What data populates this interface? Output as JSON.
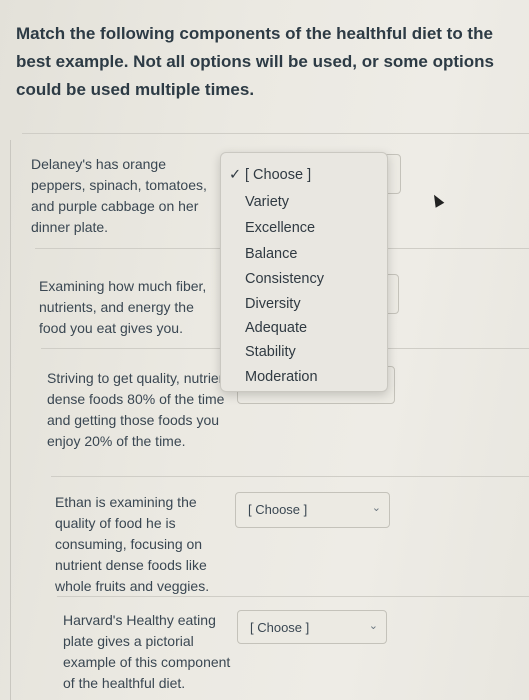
{
  "question": {
    "text": "Match the following components of the healthful diet to the best example.  Not all options will be used, or some options could be used multiple times."
  },
  "items": [
    {
      "prompt": "Delaney's has orange peppers, spinach, tomatoes, and purple cabbage on her dinner plate.",
      "selected": "[ Choose ]"
    },
    {
      "prompt": "Examining how much fiber, nutrients, and energy the food you eat gives you.",
      "selected": "[ Choose ]"
    },
    {
      "prompt": "Striving to get quality, nutrient dense foods 80% of the time and getting those foods you enjoy 20% of the time.",
      "selected": "[ Choose ]"
    },
    {
      "prompt": "Ethan is examining the quality of food he is consuming, focusing on nutrient dense foods like whole fruits and veggies.",
      "selected": "[ Choose ]"
    },
    {
      "prompt": "Harvard's Healthy eating plate gives a pictorial example of this component of the healthful diet.",
      "selected": "[ Choose ]"
    }
  ],
  "dropdown": {
    "open_for_item": 1,
    "options": [
      "[ Choose ]",
      "Variety",
      "Excellence",
      "Balance",
      "Consistency",
      "Diversity",
      "Adequate",
      "Stability",
      "Moderation"
    ],
    "checked_option": "[ Choose ]",
    "check_glyph": "✓"
  },
  "icons": {
    "chevron": "⌄"
  }
}
